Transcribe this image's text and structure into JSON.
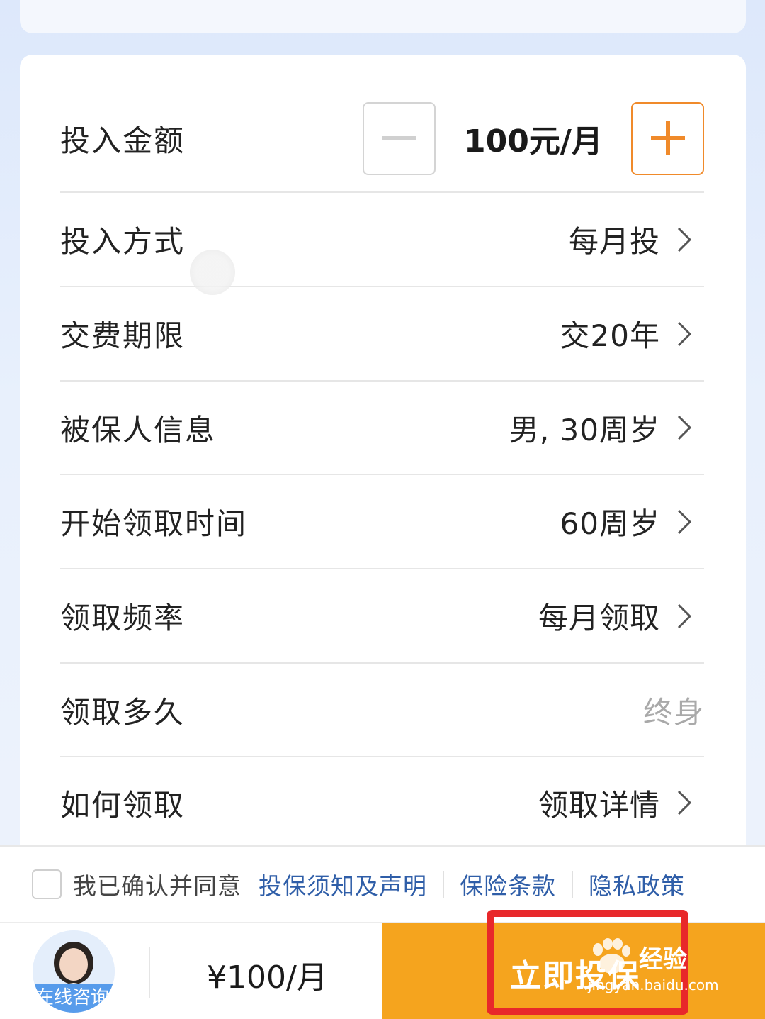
{
  "form": {
    "amount": {
      "label": "投入金额",
      "value": "100元/月"
    },
    "rows": [
      {
        "label": "投入方式",
        "value": "每月投"
      },
      {
        "label": "交费期限",
        "value": "交20年"
      },
      {
        "label": "被保人信息",
        "value": "男, 30周岁"
      },
      {
        "label": "开始领取时间",
        "value": "60周岁"
      },
      {
        "label": "领取频率",
        "value": "每月领取"
      },
      {
        "label": "领取多久",
        "value": "终身"
      },
      {
        "label": "如何领取",
        "value": "领取详情"
      }
    ]
  },
  "agreement": {
    "text": "我已确认并同意",
    "links": [
      "投保须知及声明",
      "保险条款",
      "隐私政策"
    ]
  },
  "bottom": {
    "consult_label": "在线咨询",
    "price": "¥100/月",
    "cta_label": "立即投保"
  },
  "watermark": {
    "text": "经验",
    "url": "jingyan.baidu.com"
  },
  "colors": {
    "accent_orange": "#f5a41e",
    "plus_orange": "#f08a2a",
    "link_blue": "#2f5ea8",
    "highlight_red": "#e8282a"
  }
}
